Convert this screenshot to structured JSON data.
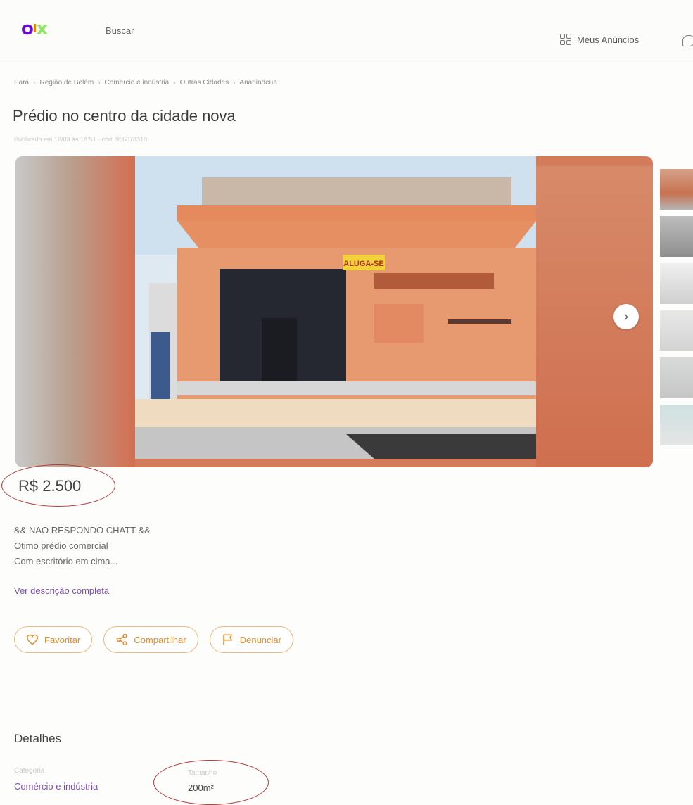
{
  "header": {
    "search_label": "Buscar",
    "meus_anuncios": "Meus Anúncios"
  },
  "breadcrumb": [
    "Pará",
    "Região de Belém",
    "Comércio e indústria",
    "Outras Cidades",
    "Ananindeua"
  ],
  "listing": {
    "title": "Prédio no centro da cidade nova",
    "published": "Publicado em 12/03 às 18:51 - cód. 956678310",
    "sign_text": "ALUGA-SE",
    "price": "R$ 2.500",
    "description_lines": [
      "&& NAO RESPONDO CHATT &&",
      "Otimo prédio comercial",
      "Com escritório em cima..."
    ],
    "more_link": "Ver descrição completa"
  },
  "actions": {
    "favorite": "Favoritar",
    "share": "Compartilhar",
    "report": "Denunciar"
  },
  "details": {
    "heading": "Detalhes",
    "category_label": "Categoria",
    "category_value": "Comércio e indústria",
    "size_label": "Tamanho",
    "size_value": "200m²"
  },
  "colors": {
    "brand_purple": "#6e0ad6",
    "brand_orange": "#f28000",
    "brand_green": "#8ce563",
    "annotation_red": "#b23a3a"
  }
}
